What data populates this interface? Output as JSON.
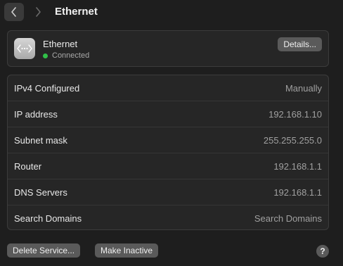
{
  "header": {
    "title": "Ethernet",
    "back_icon": "chevron-left-icon",
    "forward_icon": "chevron-right-icon"
  },
  "service": {
    "icon": "ethernet-icon",
    "name": "Ethernet",
    "status": "Connected",
    "status_color": "#30c048",
    "details_label": "Details..."
  },
  "info": {
    "rows": [
      {
        "label": "IPv4 Configured",
        "value": "Manually"
      },
      {
        "label": "IP address",
        "value": "192.168.1.10"
      },
      {
        "label": "Subnet mask",
        "value": "255.255.255.0"
      },
      {
        "label": "Router",
        "value": "192.168.1.1"
      },
      {
        "label": "DNS Servers",
        "value": "192.168.1.1"
      },
      {
        "label": "Search Domains",
        "value": "Search Domains"
      }
    ]
  },
  "footer": {
    "delete_label": "Delete Service...",
    "inactive_label": "Make Inactive",
    "help_label": "?"
  }
}
